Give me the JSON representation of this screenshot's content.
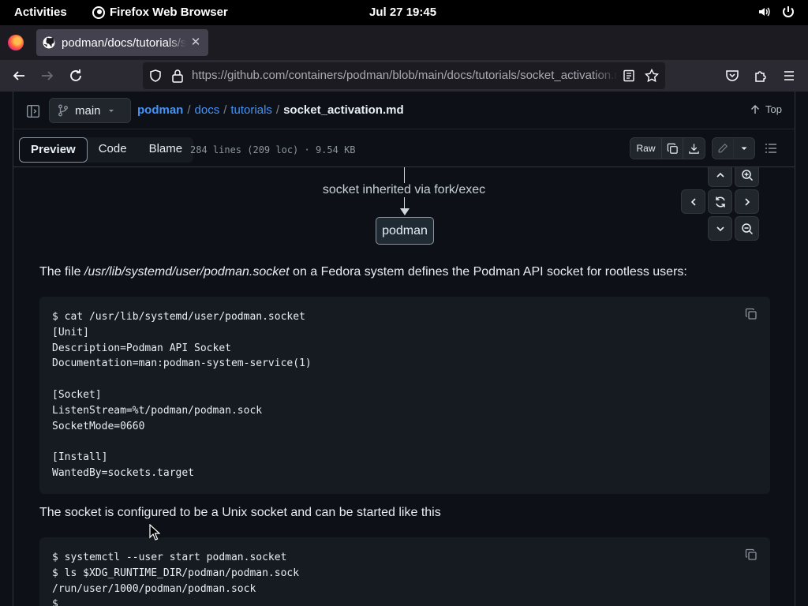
{
  "system_bar": {
    "activities": "Activities",
    "app_name": "Firefox Web Browser",
    "clock": "Jul 27  19:45"
  },
  "browser": {
    "tab_title": "podman/docs/tutorials/socket_activation.md at main · containers/podman",
    "url_host": "https://github.com",
    "url_path": "/containers/podman/blob/main/docs/tutorials/socket_activation.md"
  },
  "file_header": {
    "branch": "main",
    "breadcrumb": {
      "repo": "podman",
      "sep": "/",
      "dir1": "docs",
      "dir2": "tutorials",
      "file": "socket_activation.md"
    },
    "top_label": "Top",
    "view_tabs": [
      "Preview",
      "Code",
      "Blame"
    ],
    "file_info": "284 lines (209 loc) · 9.54 KB",
    "raw_label": "Raw"
  },
  "diagram": {
    "edge_label": "socket inherited via fork/exec",
    "node_label": "podman"
  },
  "content": {
    "para1_prefix": "The file ",
    "para1_path": "/usr/lib/systemd/user/podman.socket",
    "para1_suffix": " on a Fedora system defines the Podman API socket for rootless users:",
    "code1": "$ cat /usr/lib/systemd/user/podman.socket\n[Unit]\nDescription=Podman API Socket\nDocumentation=man:podman-system-service(1)\n\n[Socket]\nListenStream=%t/podman/podman.sock\nSocketMode=0660\n\n[Install]\nWantedBy=sockets.target",
    "para2": "The socket is configured to be a Unix socket and can be started like this",
    "code2": "$ systemctl --user start podman.socket\n$ ls $XDG_RUNTIME_DIR/podman/podman.sock\n/run/user/1000/podman/podman.sock\n$"
  },
  "icons": {
    "browser": [
      "firefox-icon",
      "github-favicon",
      "back-icon",
      "forward-icon",
      "reload-icon",
      "shield-icon",
      "lock-icon",
      "reader-view-icon",
      "bookmark-star-icon",
      "pocket-icon",
      "extensions-icon",
      "menu-icon"
    ],
    "page": [
      "sidebar-toggle-icon",
      "branch-icon",
      "arrow-up-icon",
      "copy-icon",
      "download-icon",
      "pencil-icon",
      "outline-icon",
      "zoom-in-icon",
      "zoom-out-icon",
      "reset-icon"
    ]
  },
  "colors": {
    "page_bg": "#0d1117",
    "code_bg": "#161b22",
    "link": "#4493f8",
    "border": "#30363d",
    "text": "#e6edf3",
    "muted": "#8b949e"
  }
}
